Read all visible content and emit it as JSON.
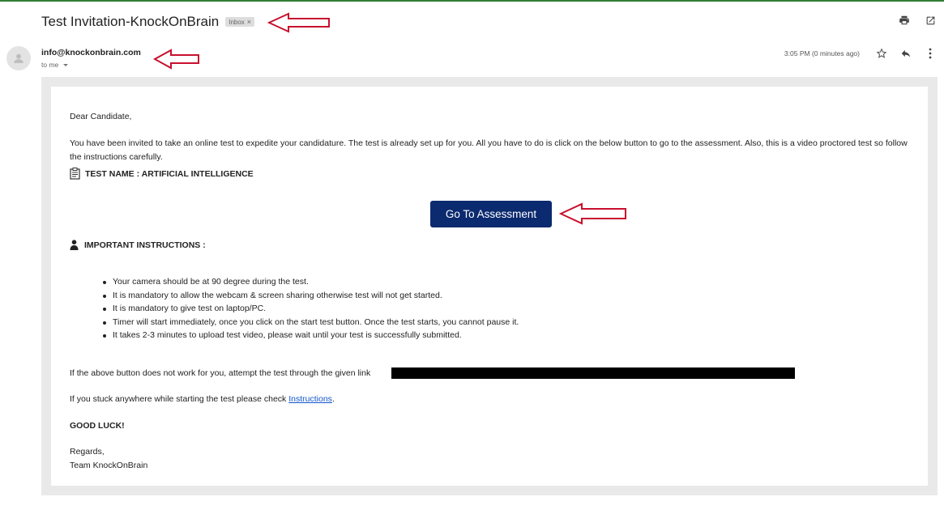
{
  "email": {
    "subject": "Test Invitation-KnockOnBrain",
    "label_badge": "Inbox",
    "label_remove": "×",
    "sender": "info@knockonbrain.com",
    "recipient": "to me",
    "time": "3:05 PM (0 minutes ago)"
  },
  "icons": {
    "print": "print-icon",
    "open_new_window": "open-in-new-window-icon",
    "star": "star-icon",
    "reply": "reply-icon",
    "more": "more-vertical-icon",
    "avatar": "person-avatar-icon",
    "test_name": "clipboard-icon",
    "instructions": "user-icon"
  },
  "body": {
    "greeting": "Dear Candidate,",
    "intro": "You have been invited to take an online test to expedite your candidature. The test is already set up for you. All you have to do is click on the below button to go to the assessment. Also, this is a video proctored test so follow the instructions carefully.",
    "test_name": "TEST NAME : ARTIFICIAL INTELLIGENCE",
    "button_label": "Go To Assessment",
    "instructions_heading": "IMPORTANT INSTRUCTIONS :",
    "instructions": [
      "Your camera should be at 90 degree during the test.",
      "It is mandatory to allow the webcam & screen sharing otherwise test will not get started.",
      "It is mandatory to give test on laptop/PC.",
      "Timer will start immediately, once you click on the start test button. Once the test starts, you cannot pause it.",
      "It takes 2-3 minutes to upload test video, please wait until your test is successfully submitted."
    ],
    "fallback_text": "If the above button does not work for you, attempt the test through the given link",
    "stuck_text": "If you stuck anywhere while starting the test please check ",
    "instructions_link": "Instructions",
    "stuck_end": ".",
    "good_luck": "GOOD LUCK!",
    "regards": "Regards,",
    "team": "Team KnockOnBrain"
  },
  "colors": {
    "button_bg": "#0b2a6f",
    "annotation_arrow": "#c8102e",
    "link": "#1155cc"
  }
}
